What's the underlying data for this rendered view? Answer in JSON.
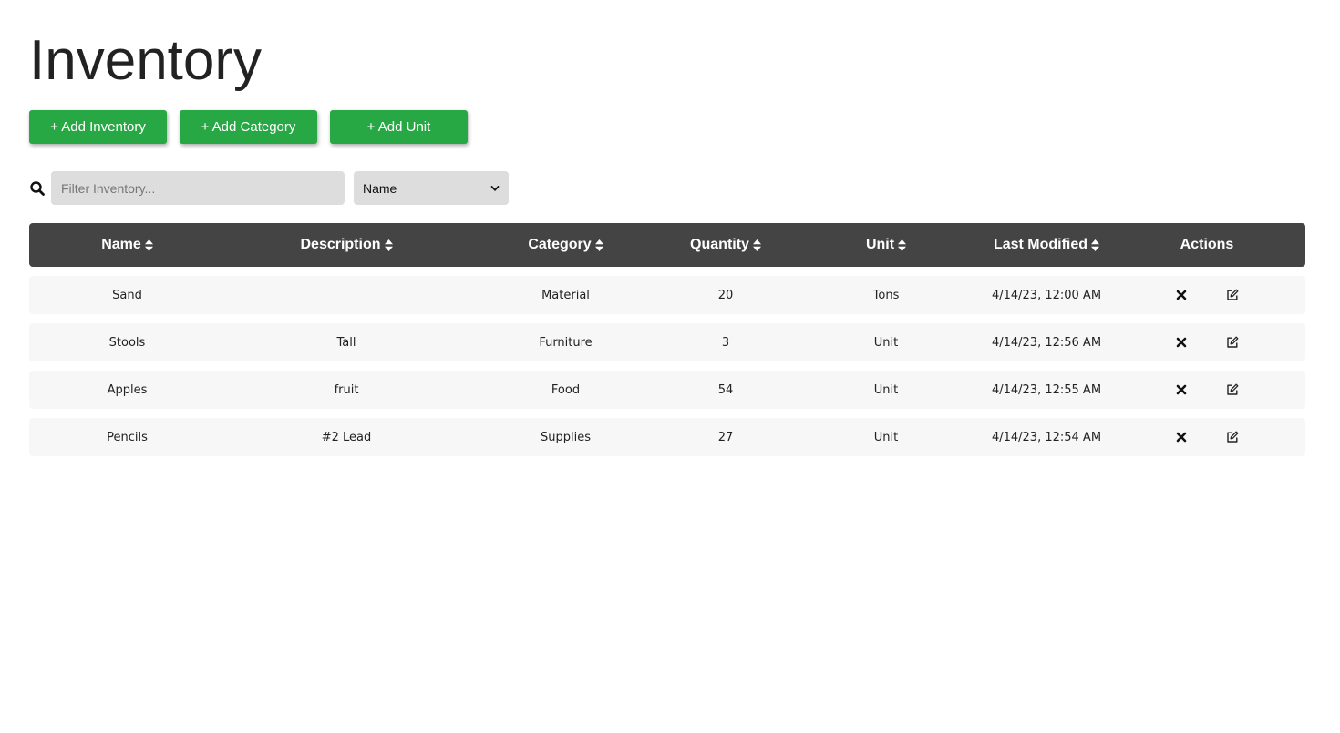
{
  "header": {
    "title": "Inventory"
  },
  "toolbar": {
    "add_inventory_label": "+ Add Inventory",
    "add_category_label": "+ Add Category",
    "add_unit_label": "+ Add Unit"
  },
  "filter": {
    "placeholder": "Filter Inventory...",
    "value": "",
    "selected_field": "Name",
    "icon": "search-icon"
  },
  "table": {
    "columns": [
      "Name",
      "Description",
      "Category",
      "Quantity",
      "Unit",
      "Last Modified",
      "Actions"
    ],
    "rows": [
      {
        "name": "Sand",
        "description": "",
        "category": "Material",
        "quantity": "20",
        "unit": "Tons",
        "last_modified": "4/14/23, 12:00 AM"
      },
      {
        "name": "Stools",
        "description": "Tall",
        "category": "Furniture",
        "quantity": "3",
        "unit": "Unit",
        "last_modified": "4/14/23, 12:56 AM"
      },
      {
        "name": "Apples",
        "description": "fruit",
        "category": "Food",
        "quantity": "54",
        "unit": "Unit",
        "last_modified": "4/14/23, 12:55 AM"
      },
      {
        "name": "Pencils",
        "description": "#2 Lead",
        "category": "Supplies",
        "quantity": "27",
        "unit": "Unit",
        "last_modified": "4/14/23, 12:54 AM"
      }
    ],
    "row_action_icons": [
      "delete-icon",
      "edit-icon"
    ]
  },
  "colors": {
    "button_green": "#28a745",
    "header_dark": "#444444",
    "row_bg": "#f7f7f7",
    "input_bg": "#dddddd"
  }
}
